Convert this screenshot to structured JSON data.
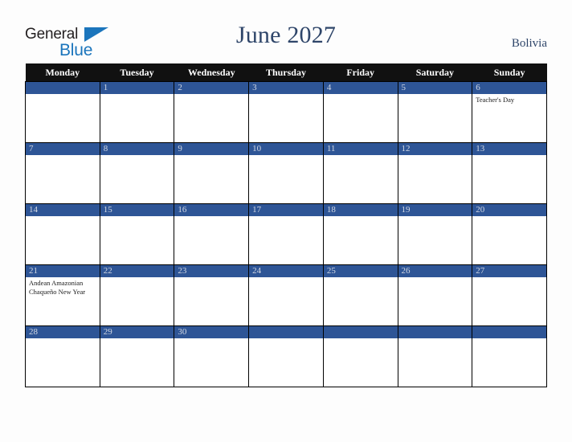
{
  "brand": {
    "name_part1": "General",
    "name_part2": "Blue",
    "triangle_icon": "triangle-icon",
    "colors": {
      "blue": "#1b75bc",
      "dark": "#231f20"
    }
  },
  "header": {
    "title": "June 2027",
    "country": "Bolivia",
    "title_color": "#2e4569"
  },
  "calendar": {
    "header_background": "#111111",
    "daynum_band_color": "#2e5596",
    "weekday_headers": [
      "Monday",
      "Tuesday",
      "Wednesday",
      "Thursday",
      "Friday",
      "Saturday",
      "Sunday"
    ],
    "weeks": [
      [
        {
          "day": "",
          "events": []
        },
        {
          "day": "1",
          "events": []
        },
        {
          "day": "2",
          "events": []
        },
        {
          "day": "3",
          "events": []
        },
        {
          "day": "4",
          "events": []
        },
        {
          "day": "5",
          "events": []
        },
        {
          "day": "6",
          "events": [
            "Teacher's Day"
          ]
        }
      ],
      [
        {
          "day": "7",
          "events": []
        },
        {
          "day": "8",
          "events": []
        },
        {
          "day": "9",
          "events": []
        },
        {
          "day": "10",
          "events": []
        },
        {
          "day": "11",
          "events": []
        },
        {
          "day": "12",
          "events": []
        },
        {
          "day": "13",
          "events": []
        }
      ],
      [
        {
          "day": "14",
          "events": []
        },
        {
          "day": "15",
          "events": []
        },
        {
          "day": "16",
          "events": []
        },
        {
          "day": "17",
          "events": []
        },
        {
          "day": "18",
          "events": []
        },
        {
          "day": "19",
          "events": []
        },
        {
          "day": "20",
          "events": []
        }
      ],
      [
        {
          "day": "21",
          "events": [
            "Andean Amazonian Chaqueño New Year"
          ]
        },
        {
          "day": "22",
          "events": []
        },
        {
          "day": "23",
          "events": []
        },
        {
          "day": "24",
          "events": []
        },
        {
          "day": "25",
          "events": []
        },
        {
          "day": "26",
          "events": []
        },
        {
          "day": "27",
          "events": []
        }
      ],
      [
        {
          "day": "28",
          "events": []
        },
        {
          "day": "29",
          "events": []
        },
        {
          "day": "30",
          "events": []
        },
        {
          "day": "",
          "events": []
        },
        {
          "day": "",
          "events": []
        },
        {
          "day": "",
          "events": []
        },
        {
          "day": "",
          "events": []
        }
      ]
    ]
  }
}
